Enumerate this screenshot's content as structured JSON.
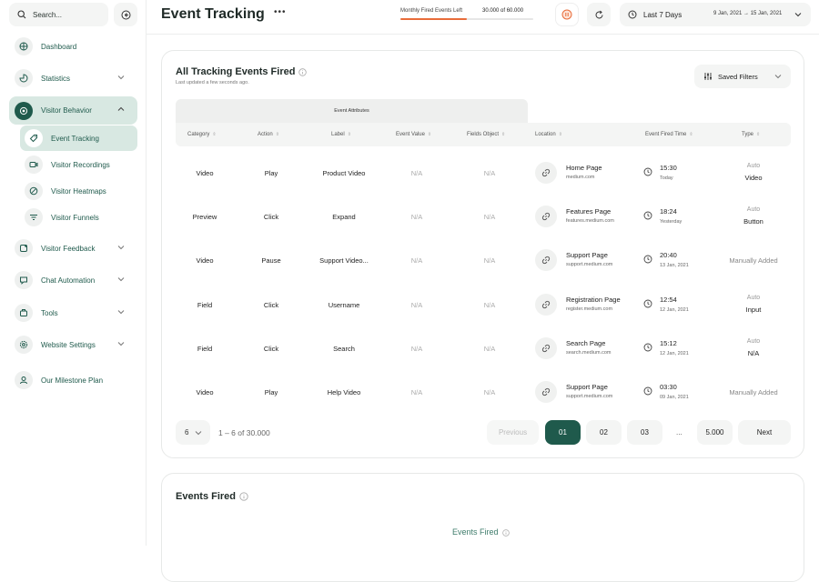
{
  "sidebar": {
    "search_placeholder": "Search...",
    "items": [
      {
        "label": "Dashboard",
        "icon": "globe-icon"
      },
      {
        "label": "Statistics",
        "icon": "chart-icon"
      },
      {
        "label": "Visitor Behavior",
        "icon": "eye-target-icon"
      },
      {
        "label": "Visitor Feedback",
        "icon": "feedback-icon"
      },
      {
        "label": "Chat Automation",
        "icon": "chat-icon"
      },
      {
        "label": "Tools",
        "icon": "toolbox-icon"
      },
      {
        "label": "Website Settings",
        "icon": "gear-icon"
      },
      {
        "label": "Our Milestone Plan",
        "icon": "user-icon"
      }
    ],
    "sub_items": [
      {
        "label": "Event Tracking",
        "icon": "tag-icon"
      },
      {
        "label": "Visitor Recordings",
        "icon": "video-icon"
      },
      {
        "label": "Visitor Heatmaps",
        "icon": "heatmap-icon"
      },
      {
        "label": "Visitor Funnels",
        "icon": "funnel-icon"
      }
    ]
  },
  "header": {
    "title": "Event Tracking",
    "quota_label": "Monthly Fired Events Left",
    "quota_value": "30.000 of 60.000",
    "quota_fraction": 0.5,
    "date_label": "Last 7 Days",
    "date_range": "9 Jan, 2021 → 15 Jan, 2021"
  },
  "card": {
    "title": "All Tracking Events Fired",
    "subtitle": "Last updated a few seconds ago.",
    "saved_filters": "Saved Filters",
    "attributes_band": "Event Attributes",
    "columns": [
      "Category",
      "Action",
      "Label",
      "Event Value",
      "Fields Object",
      "Location",
      "Event Fired Time",
      "Type"
    ],
    "rows": [
      {
        "category": "Video",
        "action": "Play",
        "label": "Product Video",
        "value": "N/A",
        "fields": "N/A",
        "loc_name": "Home Page",
        "loc_domain": "medium.com",
        "time": "15:30",
        "day": "Today",
        "type_top": "Auto",
        "type_bot": "Video",
        "type_single": ""
      },
      {
        "category": "Preview",
        "action": "Click",
        "label": "Expand",
        "value": "N/A",
        "fields": "N/A",
        "loc_name": "Features Page",
        "loc_domain": "features.medium.com",
        "time": "18:24",
        "day": "Yesterday",
        "type_top": "Auto",
        "type_bot": "Button",
        "type_single": ""
      },
      {
        "category": "Video",
        "action": "Pause",
        "label": "Support Video...",
        "value": "N/A",
        "fields": "N/A",
        "loc_name": "Support Page",
        "loc_domain": "support.medium.com",
        "time": "20:40",
        "day": "13 Jan, 2021",
        "type_top": "",
        "type_bot": "",
        "type_single": "Manually Added"
      },
      {
        "category": "Field",
        "action": "Click",
        "label": "Username",
        "value": "N/A",
        "fields": "N/A",
        "loc_name": "Registration Page",
        "loc_domain": "register.medium.com",
        "time": "12:54",
        "day": "12 Jan, 2021",
        "type_top": "Auto",
        "type_bot": "Input",
        "type_single": ""
      },
      {
        "category": "Field",
        "action": "Click",
        "label": "Search",
        "value": "N/A",
        "fields": "N/A",
        "loc_name": "Search Page",
        "loc_domain": "search.medium.com",
        "time": "15:12",
        "day": "12 Jan, 2021",
        "type_top": "Auto",
        "type_bot": "N/A",
        "type_single": ""
      },
      {
        "category": "Video",
        "action": "Play",
        "label": "Help Video",
        "value": "N/A",
        "fields": "N/A",
        "loc_name": "Support Page",
        "loc_domain": "support.medium.com",
        "time": "03:30",
        "day": "09 Jan, 2021",
        "type_top": "",
        "type_bot": "",
        "type_single": "Manually Added"
      }
    ],
    "pagination": {
      "per_page": "6",
      "range": "1 – 6 of 30.000",
      "previous": "Previous",
      "pages": [
        "01",
        "02",
        "03"
      ],
      "ellipsis": "...",
      "last": "5.000",
      "next": "Next"
    }
  },
  "card2": {
    "title": "Events Fired",
    "chart_title": "Events Fired"
  },
  "colors": {
    "accent": "#1f5a4c",
    "accent_light": "#d8e8e2",
    "quota_bar": "#e86c3a"
  }
}
